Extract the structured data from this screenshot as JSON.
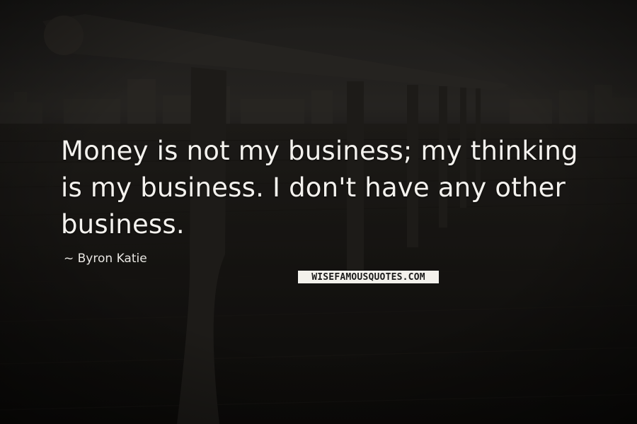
{
  "quote": {
    "text": "Money is not my business; my thinking is my business. I don't have any other business.",
    "author": "~ Byron Katie"
  },
  "watermark": {
    "text": "WISEFAMOUSQUOTES.COM"
  },
  "colors": {
    "background": "#1f1d1a",
    "text": "#f4f2ee",
    "watermark_bg": "#f3f1ec"
  }
}
